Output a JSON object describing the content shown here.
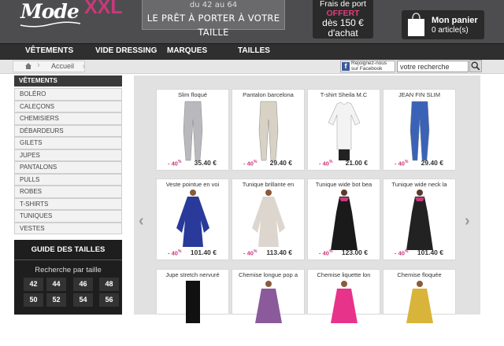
{
  "header": {
    "logo_mode": "Mode",
    "logo_xxl": "XXL",
    "banner_line1": "du 42 au 64",
    "banner_line2": "LE PRÊT À PORTER À VOTRE TAILLE",
    "shipping_line1": "Frais de port",
    "shipping_line2": "OFFERT",
    "shipping_line3": "dès 150 €",
    "shipping_line4": "d'achat",
    "cart_title": "Mon panier",
    "cart_count": "0 article(s)",
    "cart_icon": "shopping-bag-icon",
    "accent": "#c8397a"
  },
  "nav": {
    "items": [
      "VÊTEMENTS",
      "VIDE DRESSING",
      "MARQUES",
      "TAILLES"
    ]
  },
  "breadcrumb": {
    "home_icon": "home-icon",
    "label": "Accueil"
  },
  "facebook": {
    "line1": "Rejoignez-nous",
    "line2": "sur Facebook"
  },
  "search": {
    "placeholder": "votre recherche",
    "icon": "search-icon"
  },
  "sidebar": {
    "title": "VÊTEMENTS",
    "items": [
      "BOLÉRO",
      "CALEÇONS",
      "CHEMISIERS",
      "DÉBARDEURS",
      "GILETS",
      "JUPES",
      "PANTALONS",
      "PULLS",
      "ROBES",
      "T-SHIRTS",
      "TUNIQUES",
      "VESTES"
    ]
  },
  "size_guide": {
    "title": "GUIDE DES TAILLES",
    "subtitle": "Recherche par taille",
    "sizes": [
      "42",
      "44",
      "46",
      "48",
      "50",
      "52",
      "54",
      "56"
    ]
  },
  "products": [
    {
      "name": "Slim floqué",
      "discount": "- 40",
      "discount_unit": "%",
      "price": "35.40 €",
      "type": "pants",
      "color": "#b9b9bd"
    },
    {
      "name": "Pantalon barcelona",
      "discount": "- 40",
      "discount_unit": "%",
      "price": "29.40 €",
      "type": "pants",
      "color": "#d7d2c4"
    },
    {
      "name": "T-shirt Sheila M.C",
      "discount": "- 40",
      "discount_unit": "%",
      "price": "21.00 €",
      "type": "tshirt",
      "color": "#f3f3f3"
    },
    {
      "name": "JEAN FIN SLIM",
      "discount": "- 40",
      "discount_unit": "%",
      "price": "29.40 €",
      "type": "pants",
      "color": "#3a63b8"
    },
    {
      "name": "Veste pointue en voi",
      "discount": "- 40",
      "discount_unit": "%",
      "price": "101.40 €",
      "type": "tunic",
      "color": "#2a3a9a"
    },
    {
      "name": "Tunique brillante en",
      "discount": "- 40",
      "discount_unit": "%",
      "price": "113.40 €",
      "type": "tunic",
      "color": "#ddd6cf"
    },
    {
      "name": "Tunique wide bot bea",
      "discount": "- 40",
      "discount_unit": "%",
      "price": "123.00 €",
      "type": "dress",
      "color": "#1a1a1a"
    },
    {
      "name": "Tunique wide neck la",
      "discount": "- 40",
      "discount_unit": "%",
      "price": "101.40 €",
      "type": "dress",
      "color": "#222222"
    },
    {
      "name": "Jupe stretch nervuré",
      "type": "skirt",
      "color": "#111111"
    },
    {
      "name": "Chemise longue pop a",
      "type": "shirt",
      "color": "#8a5a9a"
    },
    {
      "name": "Chemise liquette lon",
      "type": "shirt",
      "color": "#e8338a"
    },
    {
      "name": "Chemise floquée",
      "type": "shirt",
      "color": "#d9b43a"
    }
  ]
}
